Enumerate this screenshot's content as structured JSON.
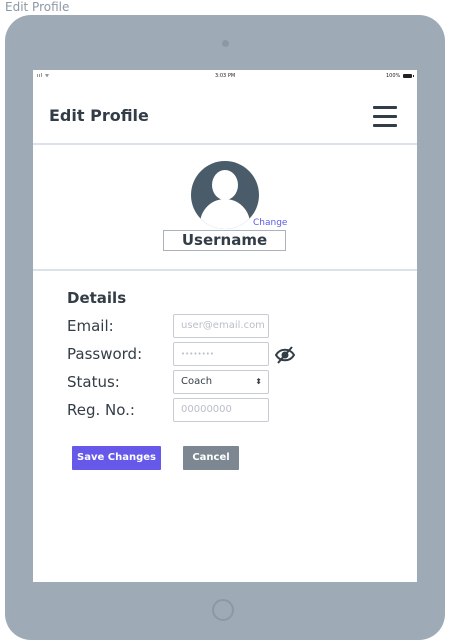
{
  "frame": {
    "label": "Edit Profile"
  },
  "status_bar": {
    "signal": "ııl ᯤ",
    "time": "3:03 PM",
    "battery_pct": "100%"
  },
  "header": {
    "title": "Edit Profile",
    "menu_icon": "hamburger-menu-icon"
  },
  "profile": {
    "avatar_icon": "user-avatar-icon",
    "change_label": "Change",
    "username": "Username"
  },
  "details": {
    "title": "Details",
    "email": {
      "label": "Email:",
      "placeholder": "user@email.com"
    },
    "password": {
      "label": "Password:",
      "placeholder": "••••••••",
      "toggle_icon": "eye-slash-icon"
    },
    "status": {
      "label": "Status:",
      "value": "Coach",
      "options": [
        "Coach"
      ]
    },
    "reg_no": {
      "label": "Reg. No.:",
      "placeholder": "00000000"
    }
  },
  "actions": {
    "save_label": "Save Changes",
    "cancel_label": "Cancel"
  },
  "colors": {
    "tablet": "#9eaab6",
    "primary": "#6658e9",
    "secondary": "#7c8792",
    "text": "#333d47",
    "avatar": "#4a5b6a",
    "link": "#5b5be8"
  }
}
